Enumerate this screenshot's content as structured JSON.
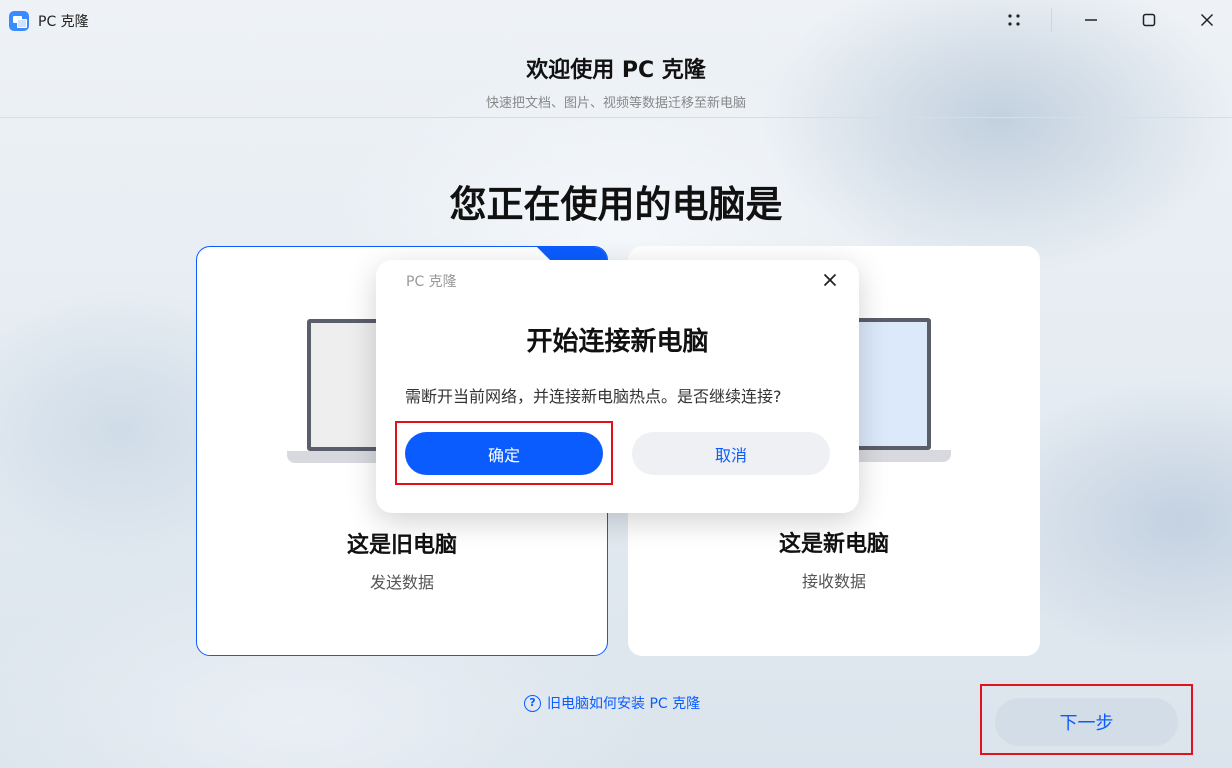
{
  "window": {
    "title": "PC 克隆",
    "controls": {
      "grid": "grid-dots-icon",
      "minimize": "minimize-icon",
      "maximize": "maximize-icon",
      "close": "close-icon"
    }
  },
  "header": {
    "title": "欢迎使用 PC 克隆",
    "subtitle": "快速把文档、图片、视频等数据迁移至新电脑"
  },
  "main": {
    "question": "您正在使用的电脑是",
    "options": [
      {
        "title": "这是旧电脑",
        "subtitle": "发送数据",
        "selected": true
      },
      {
        "title": "这是新电脑",
        "subtitle": "接收数据",
        "selected": false
      }
    ],
    "help_link": "旧电脑如何安装 PC 克隆",
    "next_button": "下一步"
  },
  "dialog": {
    "app_name": "PC 克隆",
    "title": "开始连接新电脑",
    "message": "需断开当前网络，并连接新电脑热点。是否继续连接?",
    "confirm": "确定",
    "cancel": "取消"
  },
  "colors": {
    "accent": "#0b5cff",
    "highlight": "#e3121a"
  }
}
